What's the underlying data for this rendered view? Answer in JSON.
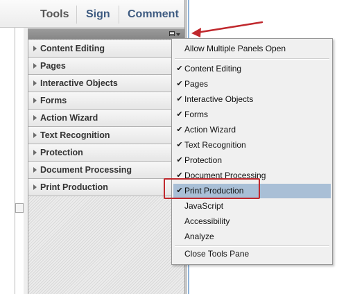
{
  "toolbar": {
    "tools_label": "Tools",
    "sign_label": "Sign",
    "comment_label": "Comment"
  },
  "pane": {
    "menu_icon": "panel-options-icon",
    "panels": [
      {
        "label": "Content Editing"
      },
      {
        "label": "Pages"
      },
      {
        "label": "Interactive Objects"
      },
      {
        "label": "Forms"
      },
      {
        "label": "Action Wizard"
      },
      {
        "label": "Text Recognition"
      },
      {
        "label": "Protection"
      },
      {
        "label": "Document Processing"
      },
      {
        "label": "Print Production"
      }
    ]
  },
  "menu": {
    "allow_multiple": "Allow Multiple Panels Open",
    "items": [
      {
        "label": "Content Editing",
        "checked": true
      },
      {
        "label": "Pages",
        "checked": true
      },
      {
        "label": "Interactive Objects",
        "checked": true
      },
      {
        "label": "Forms",
        "checked": true
      },
      {
        "label": "Action Wizard",
        "checked": true
      },
      {
        "label": "Text Recognition",
        "checked": true
      },
      {
        "label": "Protection",
        "checked": true
      },
      {
        "label": "Document Processing",
        "checked": true
      },
      {
        "label": "Print Production",
        "checked": true,
        "highlighted": true
      },
      {
        "label": "JavaScript",
        "checked": false
      },
      {
        "label": "Accessibility",
        "checked": false
      },
      {
        "label": "Analyze",
        "checked": false
      }
    ],
    "close_label": "Close Tools Pane",
    "check_glyph": "✔"
  },
  "colors": {
    "highlight": "#a9bfd6",
    "annotation_red": "#c0282d"
  }
}
